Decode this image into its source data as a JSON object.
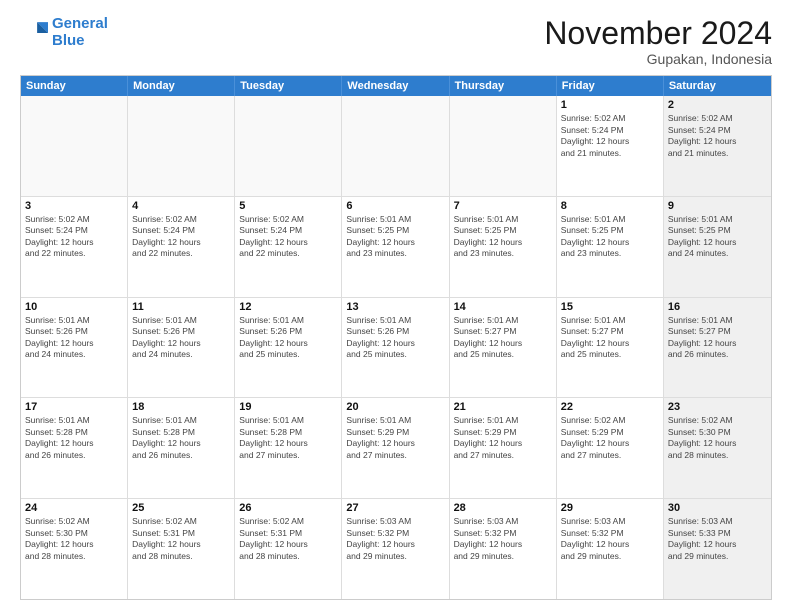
{
  "header": {
    "logo_line1": "General",
    "logo_line2": "Blue",
    "month_title": "November 2024",
    "subtitle": "Gupakan, Indonesia"
  },
  "weekdays": [
    "Sunday",
    "Monday",
    "Tuesday",
    "Wednesday",
    "Thursday",
    "Friday",
    "Saturday"
  ],
  "rows": [
    [
      {
        "day": "",
        "info": "",
        "shaded": false,
        "empty": true
      },
      {
        "day": "",
        "info": "",
        "shaded": false,
        "empty": true
      },
      {
        "day": "",
        "info": "",
        "shaded": false,
        "empty": true
      },
      {
        "day": "",
        "info": "",
        "shaded": false,
        "empty": true
      },
      {
        "day": "",
        "info": "",
        "shaded": false,
        "empty": true
      },
      {
        "day": "1",
        "info": "Sunrise: 5:02 AM\nSunset: 5:24 PM\nDaylight: 12 hours\nand 21 minutes.",
        "shaded": false,
        "empty": false
      },
      {
        "day": "2",
        "info": "Sunrise: 5:02 AM\nSunset: 5:24 PM\nDaylight: 12 hours\nand 21 minutes.",
        "shaded": true,
        "empty": false
      }
    ],
    [
      {
        "day": "3",
        "info": "Sunrise: 5:02 AM\nSunset: 5:24 PM\nDaylight: 12 hours\nand 22 minutes.",
        "shaded": false,
        "empty": false
      },
      {
        "day": "4",
        "info": "Sunrise: 5:02 AM\nSunset: 5:24 PM\nDaylight: 12 hours\nand 22 minutes.",
        "shaded": false,
        "empty": false
      },
      {
        "day": "5",
        "info": "Sunrise: 5:02 AM\nSunset: 5:24 PM\nDaylight: 12 hours\nand 22 minutes.",
        "shaded": false,
        "empty": false
      },
      {
        "day": "6",
        "info": "Sunrise: 5:01 AM\nSunset: 5:25 PM\nDaylight: 12 hours\nand 23 minutes.",
        "shaded": false,
        "empty": false
      },
      {
        "day": "7",
        "info": "Sunrise: 5:01 AM\nSunset: 5:25 PM\nDaylight: 12 hours\nand 23 minutes.",
        "shaded": false,
        "empty": false
      },
      {
        "day": "8",
        "info": "Sunrise: 5:01 AM\nSunset: 5:25 PM\nDaylight: 12 hours\nand 23 minutes.",
        "shaded": false,
        "empty": false
      },
      {
        "day": "9",
        "info": "Sunrise: 5:01 AM\nSunset: 5:25 PM\nDaylight: 12 hours\nand 24 minutes.",
        "shaded": true,
        "empty": false
      }
    ],
    [
      {
        "day": "10",
        "info": "Sunrise: 5:01 AM\nSunset: 5:26 PM\nDaylight: 12 hours\nand 24 minutes.",
        "shaded": false,
        "empty": false
      },
      {
        "day": "11",
        "info": "Sunrise: 5:01 AM\nSunset: 5:26 PM\nDaylight: 12 hours\nand 24 minutes.",
        "shaded": false,
        "empty": false
      },
      {
        "day": "12",
        "info": "Sunrise: 5:01 AM\nSunset: 5:26 PM\nDaylight: 12 hours\nand 25 minutes.",
        "shaded": false,
        "empty": false
      },
      {
        "day": "13",
        "info": "Sunrise: 5:01 AM\nSunset: 5:26 PM\nDaylight: 12 hours\nand 25 minutes.",
        "shaded": false,
        "empty": false
      },
      {
        "day": "14",
        "info": "Sunrise: 5:01 AM\nSunset: 5:27 PM\nDaylight: 12 hours\nand 25 minutes.",
        "shaded": false,
        "empty": false
      },
      {
        "day": "15",
        "info": "Sunrise: 5:01 AM\nSunset: 5:27 PM\nDaylight: 12 hours\nand 25 minutes.",
        "shaded": false,
        "empty": false
      },
      {
        "day": "16",
        "info": "Sunrise: 5:01 AM\nSunset: 5:27 PM\nDaylight: 12 hours\nand 26 minutes.",
        "shaded": true,
        "empty": false
      }
    ],
    [
      {
        "day": "17",
        "info": "Sunrise: 5:01 AM\nSunset: 5:28 PM\nDaylight: 12 hours\nand 26 minutes.",
        "shaded": false,
        "empty": false
      },
      {
        "day": "18",
        "info": "Sunrise: 5:01 AM\nSunset: 5:28 PM\nDaylight: 12 hours\nand 26 minutes.",
        "shaded": false,
        "empty": false
      },
      {
        "day": "19",
        "info": "Sunrise: 5:01 AM\nSunset: 5:28 PM\nDaylight: 12 hours\nand 27 minutes.",
        "shaded": false,
        "empty": false
      },
      {
        "day": "20",
        "info": "Sunrise: 5:01 AM\nSunset: 5:29 PM\nDaylight: 12 hours\nand 27 minutes.",
        "shaded": false,
        "empty": false
      },
      {
        "day": "21",
        "info": "Sunrise: 5:01 AM\nSunset: 5:29 PM\nDaylight: 12 hours\nand 27 minutes.",
        "shaded": false,
        "empty": false
      },
      {
        "day": "22",
        "info": "Sunrise: 5:02 AM\nSunset: 5:29 PM\nDaylight: 12 hours\nand 27 minutes.",
        "shaded": false,
        "empty": false
      },
      {
        "day": "23",
        "info": "Sunrise: 5:02 AM\nSunset: 5:30 PM\nDaylight: 12 hours\nand 28 minutes.",
        "shaded": true,
        "empty": false
      }
    ],
    [
      {
        "day": "24",
        "info": "Sunrise: 5:02 AM\nSunset: 5:30 PM\nDaylight: 12 hours\nand 28 minutes.",
        "shaded": false,
        "empty": false
      },
      {
        "day": "25",
        "info": "Sunrise: 5:02 AM\nSunset: 5:31 PM\nDaylight: 12 hours\nand 28 minutes.",
        "shaded": false,
        "empty": false
      },
      {
        "day": "26",
        "info": "Sunrise: 5:02 AM\nSunset: 5:31 PM\nDaylight: 12 hours\nand 28 minutes.",
        "shaded": false,
        "empty": false
      },
      {
        "day": "27",
        "info": "Sunrise: 5:03 AM\nSunset: 5:32 PM\nDaylight: 12 hours\nand 29 minutes.",
        "shaded": false,
        "empty": false
      },
      {
        "day": "28",
        "info": "Sunrise: 5:03 AM\nSunset: 5:32 PM\nDaylight: 12 hours\nand 29 minutes.",
        "shaded": false,
        "empty": false
      },
      {
        "day": "29",
        "info": "Sunrise: 5:03 AM\nSunset: 5:32 PM\nDaylight: 12 hours\nand 29 minutes.",
        "shaded": false,
        "empty": false
      },
      {
        "day": "30",
        "info": "Sunrise: 5:03 AM\nSunset: 5:33 PM\nDaylight: 12 hours\nand 29 minutes.",
        "shaded": true,
        "empty": false
      }
    ]
  ]
}
